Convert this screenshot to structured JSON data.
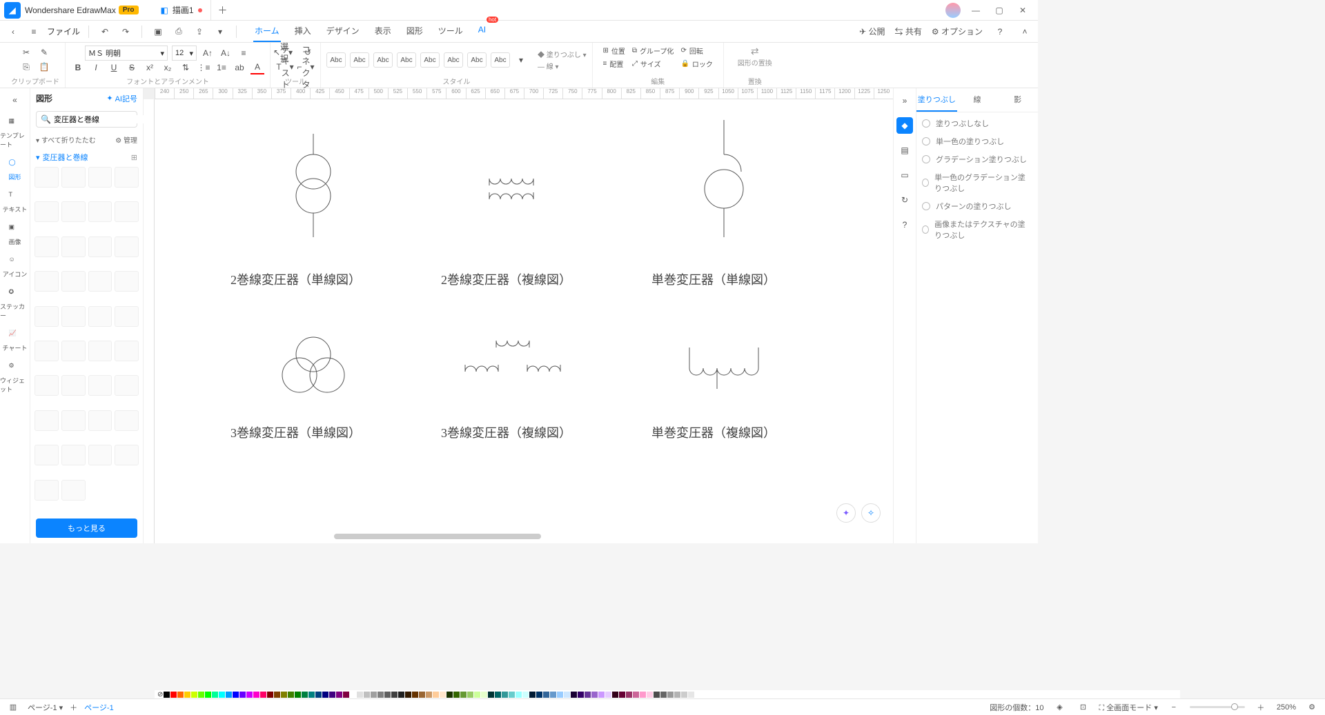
{
  "app": {
    "name": "Wondershare EdrawMax",
    "badge": "Pro"
  },
  "tab": {
    "title": "描画1"
  },
  "menu": {
    "file": "ファイル",
    "tabs": [
      "ホーム",
      "挿入",
      "デザイン",
      "表示",
      "図形",
      "ツール",
      "AI"
    ],
    "active": "ホーム",
    "hot": "hot",
    "right": {
      "publish": "公開",
      "share": "共有",
      "options": "オプション"
    }
  },
  "ribbon": {
    "clipboard": "クリップボード",
    "font_name": "ＭＳ 明朝",
    "font_size": "12",
    "font_group": "フォントとアラインメント",
    "select": "選択",
    "text": "テキスト",
    "connector": "コネクタ",
    "tool_group": "ツール",
    "style_label": "Abc",
    "style_group": "スタイル",
    "fill": "塗りつぶし",
    "line": "線",
    "arrange": {
      "position": "位置",
      "align": "配置",
      "group": "グループ化",
      "size": "サイズ",
      "rotate": "回転",
      "lock": "ロック"
    },
    "edit_group": "編集",
    "replace": "図形の置換",
    "replace_group": "置換"
  },
  "vstrip": {
    "template": "テンプレート",
    "shapes": "図形",
    "text": "テキスト",
    "image": "画像",
    "icon": "アイコン",
    "sticker": "ステッカー",
    "chart": "チャート",
    "widget": "ウィジェット"
  },
  "shapes_panel": {
    "title": "図形",
    "ai": "AI記号",
    "search": "変圧器と巻線",
    "fold": "すべて折りたたむ",
    "manage": "管理",
    "section": "変圧器と巻線",
    "more": "もっと見る"
  },
  "canvas_labels": {
    "r1c1": "2巻線変圧器（単線図）",
    "r1c2": "2巻線変圧器（複線図）",
    "r1c3": "単巻変圧器（単線図）",
    "r2c1": "3巻線変圧器（単線図）",
    "r2c2": "3巻線変圧器（複線図）",
    "r2c3": "単巻変圧器（複線図）"
  },
  "ruler_h": [
    "240",
    "250",
    "265",
    "300",
    "325",
    "350",
    "375",
    "400",
    "425",
    "450",
    "475",
    "500",
    "525",
    "550",
    "575",
    "600",
    "625",
    "650",
    "675",
    "700",
    "725",
    "750",
    "775",
    "800",
    "825",
    "850",
    "875",
    "900",
    "925",
    "1050",
    "1075",
    "1100",
    "1125",
    "1150",
    "1175",
    "1200",
    "1225",
    "1250"
  ],
  "rpanel": {
    "tabs": [
      "塗りつぶし",
      "線",
      "影"
    ],
    "opts": [
      "塗りつぶしなし",
      "単一色の塗りつぶし",
      "グラデーション塗りつぶし",
      "単一色のグラデーション塗りつぶし",
      "パターンの塗りつぶし",
      "画像またはテクスチャの塗りつぶし"
    ]
  },
  "status": {
    "page_sel": "ページ-1",
    "page_tab": "ページ-1",
    "shape_count_label": "図形の個数：",
    "shape_count": "10",
    "fullscreen": "全画面モード",
    "zoom": "250%"
  },
  "colorbar": [
    "#000000",
    "#ff0000",
    "#ff6600",
    "#ffcc00",
    "#ccff00",
    "#66ff00",
    "#00ff00",
    "#00ff99",
    "#00ffff",
    "#0099ff",
    "#0000ff",
    "#6600ff",
    "#cc00ff",
    "#ff00cc",
    "#ff0066",
    "#800000",
    "#804000",
    "#808000",
    "#408000",
    "#008000",
    "#008040",
    "#008080",
    "#004080",
    "#000080",
    "#400080",
    "#800080",
    "#800040",
    "#ffffff",
    "#e0e0e0",
    "#c0c0c0",
    "#a0a0a0",
    "#808080",
    "#606060",
    "#404040",
    "#202020",
    "#331a00",
    "#663300",
    "#996633",
    "#cc9966",
    "#ffcc99",
    "#ffe6cc",
    "#1a3300",
    "#336600",
    "#669933",
    "#99cc66",
    "#ccff99",
    "#e6ffcc",
    "#003333",
    "#006666",
    "#339999",
    "#66cccc",
    "#99ffff",
    "#ccffff",
    "#001a33",
    "#003366",
    "#336699",
    "#6699cc",
    "#99ccff",
    "#cce6ff",
    "#1a0033",
    "#330066",
    "#663399",
    "#9966cc",
    "#cc99ff",
    "#e6ccff",
    "#33001a",
    "#660033",
    "#993366",
    "#cc6699",
    "#ff99cc",
    "#ffccE6",
    "#4d4d4d",
    "#666666",
    "#999999",
    "#b3b3b3",
    "#cccccc",
    "#e6e6e6"
  ]
}
